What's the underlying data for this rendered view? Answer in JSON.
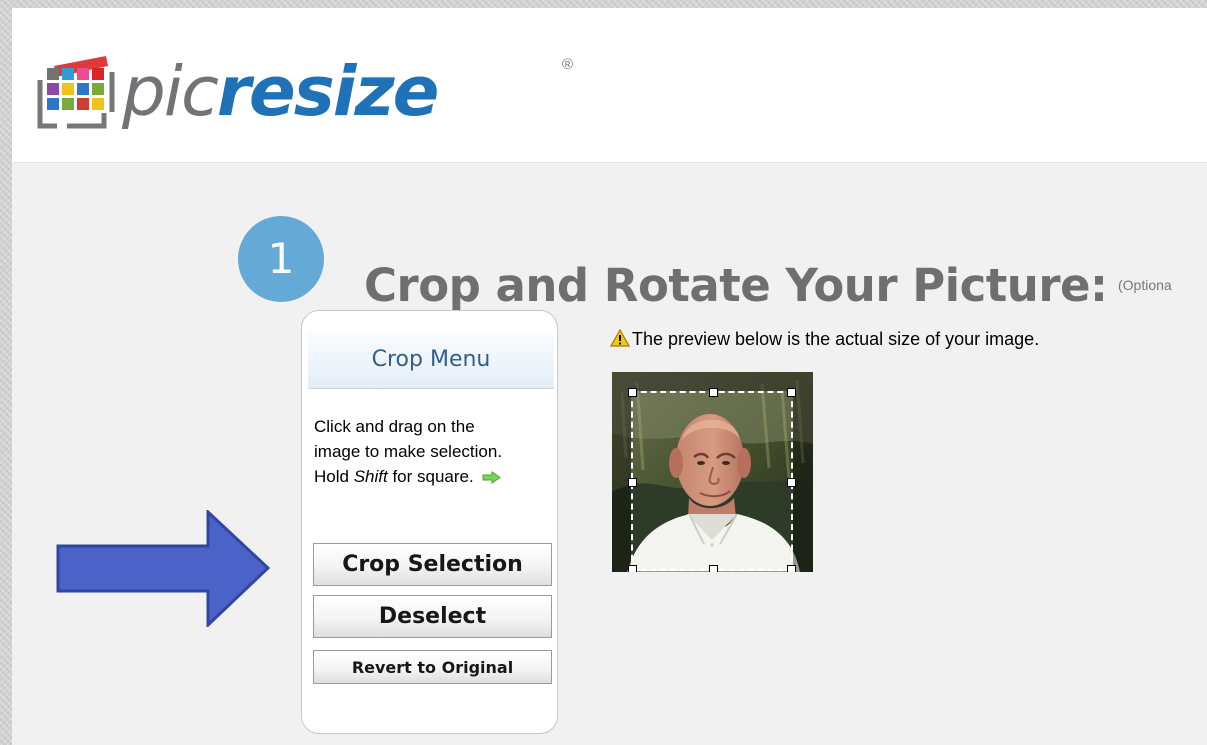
{
  "brand": {
    "logo_mark": "picture-mosaic-logo",
    "pic": "pic",
    "resize": "resize",
    "registered": "®",
    "colors": {
      "gray": "#717377",
      "blue": "#1f71b8",
      "red": "#dc2424",
      "green": "#7aaa3b",
      "yellow": "#f0c21b",
      "purple": "#8b4aa0"
    }
  },
  "section": {
    "step_number": "1",
    "title": "Crop and Rotate Your Picture:",
    "optional_note": "(Optiona"
  },
  "crop_menu": {
    "heading": "Crop Menu",
    "instruction": {
      "line1": "Click and drag on the",
      "line2": "image to make selection.",
      "line3_prefix": "Hold ",
      "line3_key": "Shift",
      "line3_suffix": " for square."
    },
    "buttons": {
      "crop_selection": "Crop Selection",
      "deselect": "Deselect",
      "revert": "Revert to Original"
    }
  },
  "preview": {
    "warning_text": "The preview below is the actual size of your image.",
    "image_subject": "man-portrait",
    "selection_state": "active-crop-selection"
  },
  "annotation": {
    "arrow_icon": "blue-right-arrow",
    "color": "#4b62c8"
  }
}
